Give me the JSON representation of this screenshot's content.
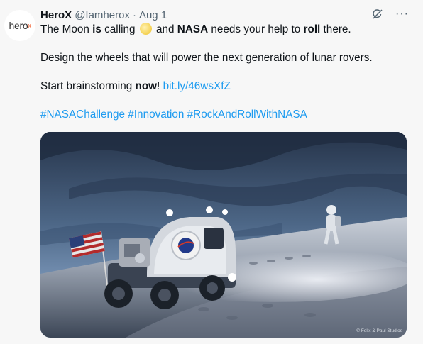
{
  "author": {
    "avatar_text": "hero",
    "avatar_mark": "x",
    "name": "HeroX",
    "handle": "@Iamherox",
    "separator": "·",
    "date": "Aug 1"
  },
  "icons": {
    "grok": "grok-icon",
    "more": "more-icon",
    "moon": "full-moon-emoji"
  },
  "actions": {
    "more_label": "···"
  },
  "tweet": {
    "l1_a": "The Moon ",
    "l1_b": "is",
    "l1_c": " calling ",
    "l1_d": " and ",
    "l1_e": "NASA",
    "l1_f": " needs your help to ",
    "l1_g": "roll",
    "l1_h": " there.",
    "l2": "Design the wheels that will power the next generation of lunar rovers.",
    "l3_a": "Start brainstorming ",
    "l3_b": "now",
    "l3_c": "! ",
    "link": "bit.ly/46wsXfZ",
    "hashtags": "#NASAChallenge #Innovation #RockAndRollWithNASA"
  },
  "media": {
    "watermark": "© Felix & Paul Studios"
  },
  "colors": {
    "link": "#1d9bf0",
    "secondary_text": "#536471",
    "brand_accent": "#f05a28"
  }
}
